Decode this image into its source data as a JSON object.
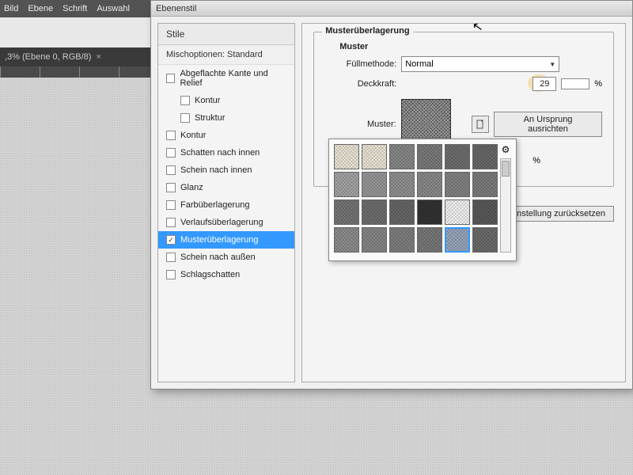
{
  "menu": {
    "items": [
      "Bild",
      "Ebene",
      "Schrift",
      "Auswahl"
    ]
  },
  "tab": {
    "label": ",3% (Ebene 0, RGB/8)",
    "close": "×"
  },
  "dialog": {
    "title": "Ebenenstil",
    "styles_header": "Stile",
    "blend_header": "Mischoptionen: Standard",
    "items": [
      {
        "label": "Abgeflachte Kante und Relief",
        "checked": false,
        "sub": false
      },
      {
        "label": "Kontur",
        "checked": false,
        "sub": true
      },
      {
        "label": "Struktur",
        "checked": false,
        "sub": true
      },
      {
        "label": "Kontur",
        "checked": false,
        "sub": false
      },
      {
        "label": "Schatten nach innen",
        "checked": false,
        "sub": false
      },
      {
        "label": "Schein nach innen",
        "checked": false,
        "sub": false
      },
      {
        "label": "Glanz",
        "checked": false,
        "sub": false
      },
      {
        "label": "Farbüberlagerung",
        "checked": false,
        "sub": false
      },
      {
        "label": "Verlaufsüberlagerung",
        "checked": false,
        "sub": false
      },
      {
        "label": "Musterüberlagerung",
        "checked": true,
        "sub": false,
        "selected": true
      },
      {
        "label": "Schein nach außen",
        "checked": false,
        "sub": false
      },
      {
        "label": "Schlagschatten",
        "checked": false,
        "sub": false
      }
    ]
  },
  "panel": {
    "group_title": "Musterüberlagerung",
    "group_sub": "Muster",
    "fillmethod_label": "Füllmethode:",
    "fillmethod_value": "Normal",
    "opacity_label": "Deckkraft:",
    "opacity_value": "29",
    "opacity_unit": "%",
    "pattern_label": "Muster:",
    "snap_label": "An Ursprung ausrichten",
    "scale_unit": "%",
    "reset_label": "einstellung zurücksetzen"
  },
  "picker": {
    "gear": "⚙",
    "swatches": [
      "#efe8d8",
      "#efe8d8",
      "#8a8a8a",
      "#7d7d7d",
      "#707070",
      "#6a6a6a",
      "#a6a6a6",
      "#9a9a9a",
      "#939393",
      "#8c8c8c",
      "#858585",
      "#7e7e7e",
      "#777777",
      "#707070",
      "#696969",
      "#333333",
      "#f5f5f5",
      "#5c5c5c",
      "#8f8f8f",
      "#888888",
      "#818181",
      "#7a7a7a",
      "#9aa8c0",
      "#6d6d6d"
    ],
    "selected_index": 22
  }
}
